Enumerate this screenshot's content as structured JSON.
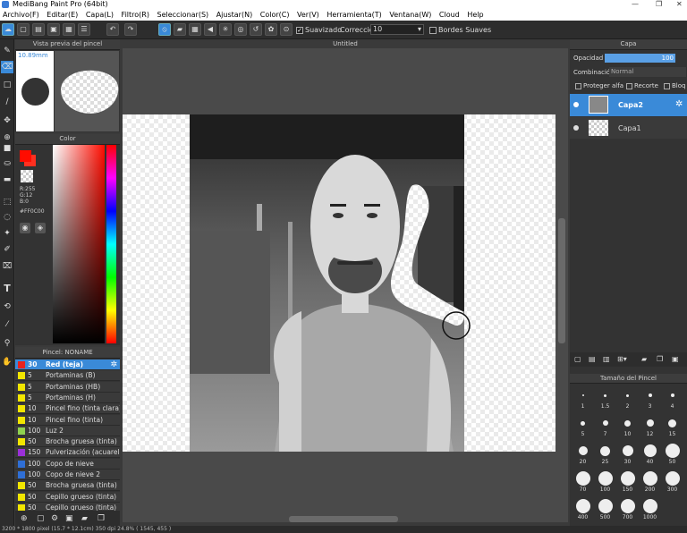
{
  "window": {
    "title": "MediBang Paint Pro (64bit)",
    "controls": [
      "—",
      "❐",
      "✕"
    ]
  },
  "menu": [
    "Archivo(F)",
    "Editar(E)",
    "Capa(L)",
    "Filtro(R)",
    "Seleccionar(S)",
    "Ajustar(N)",
    "Color(C)",
    "Ver(V)",
    "Herramienta(T)",
    "Ventana(W)",
    "Cloud",
    "Help"
  ],
  "toolbar": {
    "smoothing_label": "Suavizado",
    "correction_label": "Corrección",
    "correction_value": "10",
    "soft_edges_label": "Bordes Suaves"
  },
  "preview_panel": {
    "title": "Vista previa del pincel",
    "size": "10.89mm"
  },
  "color_panel": {
    "title": "Color",
    "r": "R:255",
    "g": "G:12",
    "b": "B:0",
    "hex": "#FF0C00"
  },
  "brush_panel": {
    "title": "Pincel: NONAME",
    "items": [
      {
        "size": "30",
        "name": "Red (teja)",
        "color": "#e8231f",
        "active": true
      },
      {
        "size": "5",
        "name": "Portaminas (B)",
        "color": "#f2e600"
      },
      {
        "size": "5",
        "name": "Portaminas (HB)",
        "color": "#f2e600"
      },
      {
        "size": "5",
        "name": "Portaminas (H)",
        "color": "#f2e600"
      },
      {
        "size": "10",
        "name": "Pincel fino (tinta clara)",
        "color": "#f2e600"
      },
      {
        "size": "10",
        "name": "Pincel fino (tinta)",
        "color": "#f2e600"
      },
      {
        "size": "100",
        "name": "Luz 2",
        "color": "#8fd14f"
      },
      {
        "size": "50",
        "name": "Brocha gruesa (tinta)",
        "color": "#f2e600"
      },
      {
        "size": "150",
        "name": "Pulverización (acuarela)",
        "color": "#9b30d9"
      },
      {
        "size": "100",
        "name": "Copo de nieve",
        "color": "#2f6fd6"
      },
      {
        "size": "100",
        "name": "Copo de nieve 2",
        "color": "#2f6fd6"
      },
      {
        "size": "50",
        "name": "Brocha gruesa (tinta)",
        "color": "#f2e600"
      },
      {
        "size": "50",
        "name": "Cepillo grueso (tinta)",
        "color": "#f2e600"
      },
      {
        "size": "50",
        "name": "Cepillo grueso (tinta)",
        "color": "#f2e600"
      }
    ]
  },
  "document": {
    "tab": "Untitled"
  },
  "layer_panel": {
    "title": "Capa",
    "opacity_label": "Opacidad",
    "opacity_value": "100",
    "blend_label": "Combinación",
    "blend_value": "Normal",
    "protect_alpha": "Proteger alfa",
    "clip": "Recorte",
    "lock": "Bloquear",
    "layers": [
      {
        "name": "Capa2",
        "active": true
      },
      {
        "name": "Capa1",
        "active": false
      }
    ]
  },
  "brush_size_panel": {
    "title": "Tamaño del Pincel",
    "sizes": [
      "1",
      "1.5",
      "2",
      "3",
      "4",
      "5",
      "7",
      "10",
      "12",
      "15",
      "20",
      "25",
      "30",
      "40",
      "50",
      "70",
      "100",
      "150",
      "200",
      "300",
      "400",
      "500",
      "700",
      "1000"
    ]
  },
  "status": {
    "text": "3200 * 1800 pixel  (15.7 * 12.1cm)  350 dpi  24.8%  ( 1545, 455 )"
  }
}
